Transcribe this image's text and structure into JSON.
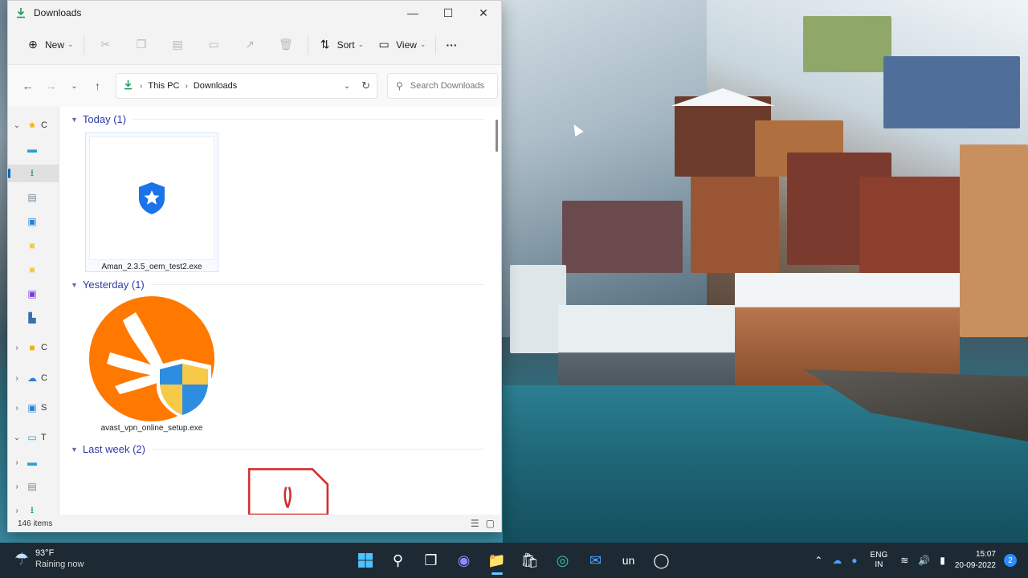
{
  "window": {
    "title": "Downloads"
  },
  "titlebar": {
    "minimize_icon": "minimize-icon",
    "maximize_icon": "maximize-icon",
    "close_icon": "close-icon"
  },
  "toolbar": {
    "new_label": "New",
    "sort_label": "Sort",
    "view_label": "View",
    "more_label": "···"
  },
  "address": {
    "segments": [
      "This PC",
      "Downloads"
    ]
  },
  "search": {
    "placeholder": "Search Downloads"
  },
  "nav": {
    "items": [
      {
        "label": "C",
        "icon": "star-icon",
        "color": "#f2b100"
      },
      {
        "label": "",
        "icon": "desktop-icon",
        "color": "#2a9fd6"
      },
      {
        "label": "",
        "icon": "download-icon",
        "color": "#0f9d58"
      },
      {
        "label": "",
        "icon": "document-icon",
        "color": "#7a8a99"
      },
      {
        "label": "",
        "icon": "pictures-icon",
        "color": "#2a7fd6"
      },
      {
        "label": "",
        "icon": "folder-icon",
        "color": "#f2c94c"
      },
      {
        "label": "",
        "icon": "folder-icon",
        "color": "#f2c94c"
      },
      {
        "label": "",
        "icon": "onenote-icon",
        "color": "#7b3fd6"
      },
      {
        "label": "",
        "icon": "chart-icon",
        "color": "#3a6fb0"
      },
      {
        "label": "C",
        "icon": "folder-person-icon",
        "color": "#f2b100"
      },
      {
        "label": "C",
        "icon": "cloud-icon",
        "color": "#2a7fd6"
      },
      {
        "label": "S",
        "icon": "share-icon",
        "color": "#2a7fd6"
      },
      {
        "label": "T",
        "icon": "thispc-icon",
        "color": "#2a9fd6"
      },
      {
        "label": "",
        "icon": "desktop-icon",
        "color": "#2a9fd6"
      },
      {
        "label": "",
        "icon": "document-icon",
        "color": "#7a8a99"
      },
      {
        "label": "",
        "icon": "download-icon",
        "color": "#0f9d58"
      }
    ]
  },
  "groups": [
    {
      "label": "Today (1)"
    },
    {
      "label": "Yesterday (1)"
    },
    {
      "label": "Last week (2)"
    }
  ],
  "files": [
    {
      "name": "Aman_2.3.5_oem_test2.exe",
      "icon": "shield-star-icon"
    },
    {
      "name": "avast_vpn_online_setup.exe",
      "icon": "avast-vpn-icon"
    },
    {
      "name": "",
      "icon": "pdf-icon"
    }
  ],
  "status": {
    "items_count": "146 items"
  },
  "taskbar": {
    "weather": {
      "temp": "93°F",
      "condition": "Raining now"
    },
    "apps": [
      "windows-start-icon",
      "search-icon",
      "taskview-icon",
      "teams-icon",
      "file-explorer-icon",
      "store-icon",
      "edge-icon",
      "mail-icon",
      "un",
      "chrome-icon"
    ],
    "language": {
      "line1": "ENG",
      "line2": "IN"
    },
    "time": "15:07",
    "date": "20-09-2022",
    "notification_count": "2"
  }
}
